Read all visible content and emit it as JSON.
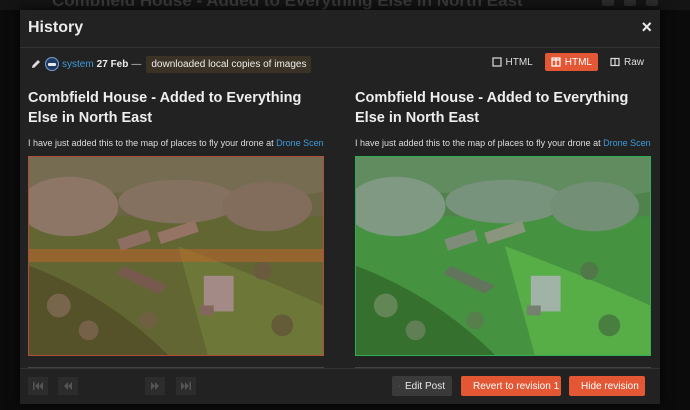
{
  "background": {
    "title": "Combfield House - Added to Everything Else in North East"
  },
  "modal": {
    "title": "History",
    "close_label": "×"
  },
  "revision": {
    "user": "system",
    "date": "27 Feb",
    "separator": "—",
    "edit_reason": "downloaded local copies of images"
  },
  "view_modes": [
    {
      "label": "HTML",
      "icon": "square-icon",
      "active": false
    },
    {
      "label": "HTML",
      "icon": "columns-icon",
      "active": true
    },
    {
      "label": "Raw",
      "icon": "book-icon",
      "active": false
    }
  ],
  "previous": {
    "title": "Combfield House - Added to Everything Else in North East",
    "text": "I have just added this to the map of places to fly your drone at ",
    "link": "Drone Scene",
    "suffix": ":"
  },
  "current": {
    "title": "Combfield House - Added to Everything Else in North East",
    "text": "I have just added this to the map of places to fly your drone at ",
    "link": "Drone Scene",
    "suffix": ":"
  },
  "footer": {
    "nav": [
      "first-icon",
      "previous-icon",
      "next-icon",
      "last-icon"
    ],
    "edit_post": "Edit Post",
    "revert": "Revert to revision 1",
    "hide": "Hide revision"
  },
  "colors": {
    "accent": "#e45735",
    "link": "#3d9bd9",
    "removed": "#b04e3a",
    "added": "#2fae55"
  }
}
